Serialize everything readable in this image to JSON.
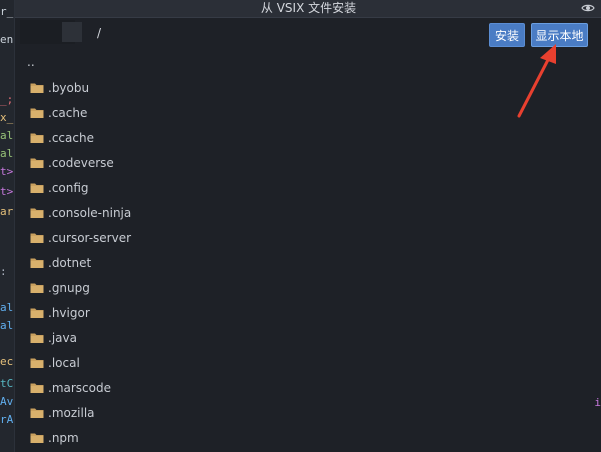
{
  "background": {
    "code_fragments": [
      "r_",
      "en",
      "_;",
      "x_",
      "al",
      "al",
      "t>",
      "t>",
      "ar",
      ":",
      "al",
      "al",
      "ec",
      "tC",
      "Av",
      "rA"
    ],
    "right_fragment": "i"
  },
  "dialog": {
    "title": "从 VSIX 文件安装",
    "path_text": "/",
    "buttons": {
      "install": "安装",
      "show_local": "显示本地"
    },
    "parent_dir": "..",
    "folders": [
      ".byobu",
      ".cache",
      ".ccache",
      ".codeverse",
      ".config",
      ".console-ninja",
      ".cursor-server",
      ".dotnet",
      ".gnupg",
      ".hvigor",
      ".java",
      ".local",
      ".marscode",
      ".mozilla",
      ".npm"
    ]
  },
  "colors": {
    "accent_button": "#4a7cc4",
    "folder_icon": "#c9a05e",
    "annotation_arrow": "#e8402f"
  },
  "icons": {
    "title_right": "eye-icon",
    "folder": "folder-icon"
  }
}
